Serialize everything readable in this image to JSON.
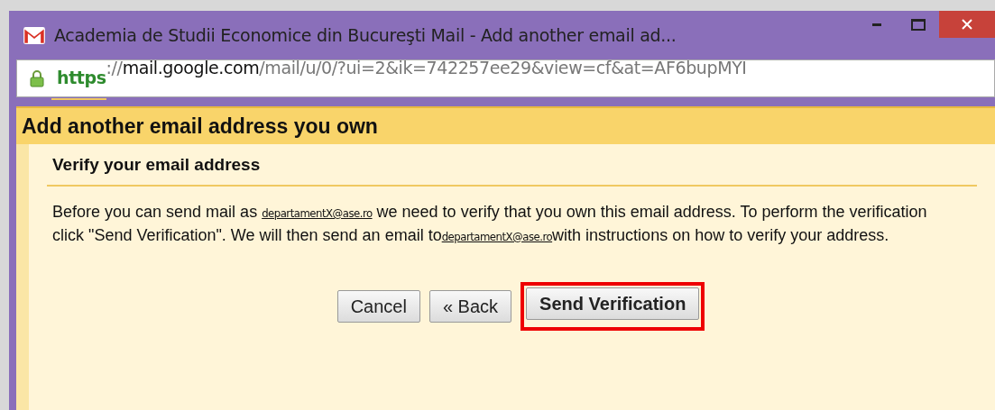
{
  "window": {
    "title": "Academia de Studii Economice din Bucureşti Mail - Add another email ad...",
    "secure": true,
    "url": {
      "scheme": "https",
      "separator": "://",
      "host": "mail.google.com",
      "path": "/mail/u/0/?ui=2&ik=742257ee29&view=cf&at=AF6bupMYI"
    }
  },
  "dialog": {
    "title": "Add another email address you own",
    "section_title": "Verify your email address",
    "message": [
      {
        "kind": "text",
        "text": "Before you can send mail as "
      },
      {
        "kind": "email",
        "text": "departamentX@ase.ro"
      },
      {
        "kind": "text",
        "text": " we need to verify that you own this email address. To perform the verification click \"Send Verification\". We will then send an email to"
      },
      {
        "kind": "email",
        "text": "departamentX@ase.ro"
      },
      {
        "kind": "text",
        "text": "with instructions on how to verify your address."
      }
    ],
    "buttons": [
      {
        "label": "Cancel",
        "primary": false,
        "highlighted": false
      },
      {
        "label": "« Back",
        "primary": false,
        "highlighted": false
      },
      {
        "label": "Send Verification",
        "primary": true,
        "highlighted": true
      }
    ]
  }
}
